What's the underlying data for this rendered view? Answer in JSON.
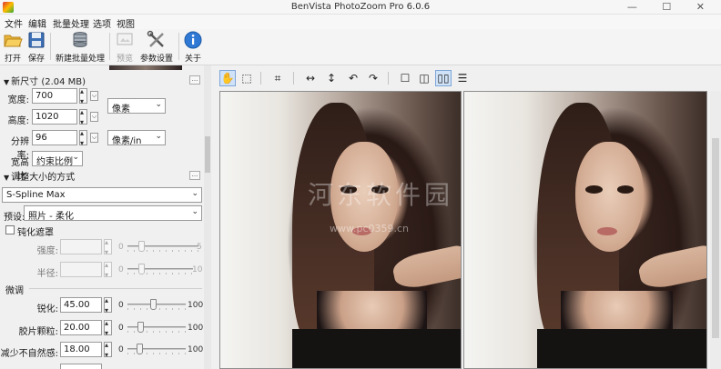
{
  "window": {
    "title": "BenVista PhotoZoom Pro 6.0.6",
    "controls": "—  ☐  ✕"
  },
  "menu": [
    "文件",
    "编辑",
    "批量处理",
    "选项",
    "视图"
  ],
  "toolbar": {
    "open": "打开",
    "save": "保存",
    "new_batch": "新建批量处理",
    "preview": "预览",
    "settings": "参数设置",
    "about": "关于"
  },
  "new_size": {
    "header": "新尺寸 (2.04 MB)",
    "width_label": "宽度:",
    "width_value": "700",
    "height_label": "高度:",
    "height_value": "1020",
    "unit_pixels": "像素",
    "resolution_label": "分辨率:",
    "resolution_value": "96",
    "resolution_unit": "像素/in",
    "aspect_label": "宽高比:",
    "aspect_value": "约束比例"
  },
  "resize_method": {
    "header": "调整大小的方式",
    "method": "S-Spline Max",
    "preset_label": "预设:",
    "preset_value": "照片 - 柔化"
  },
  "unsharp": {
    "label": "钝化遮罩",
    "strength_label": "强度:",
    "strength_min": "0",
    "strength_max": "5",
    "radius_label": "半径:",
    "radius_min": "0",
    "radius_max": "10"
  },
  "finetune": {
    "header": "微调",
    "sharpen_label": "锐化:",
    "sharpen_value": "45.00",
    "sharpen_min": "0",
    "sharpen_max": "100",
    "grain_label": "胶片颗粒:",
    "grain_value": "20.00",
    "grain_min": "0",
    "grain_max": "100",
    "artifact_label": "减少不自然感:",
    "artifact_value": "18.00",
    "artifact_min": "0",
    "artifact_max": "100"
  },
  "watermark": {
    "text": "河东软件园",
    "url": "www.pc0359.cn"
  },
  "colors": {
    "accent": "#cfe2f7",
    "toolbar_bg": "#f4f4f4"
  }
}
